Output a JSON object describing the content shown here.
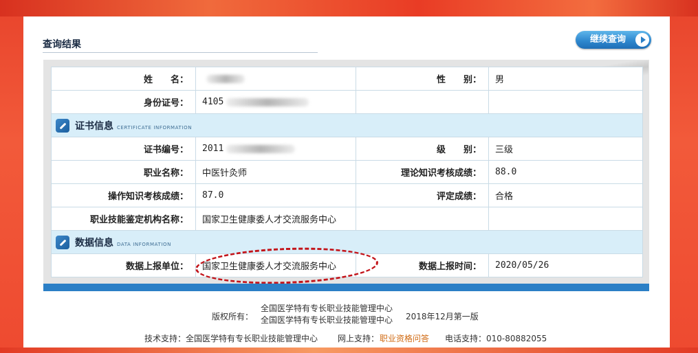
{
  "header": {
    "title": "查询结果",
    "continue_button": "继续查询"
  },
  "personal": {
    "name_label": "姓　　名：",
    "name_value": "",
    "gender_label": "性　　别：",
    "gender_value": "男",
    "id_label": "身份证号：",
    "id_value": "4105"
  },
  "certificate": {
    "section_title": "证书信息",
    "section_en": "CERTIFICATE INFORMATION",
    "cert_no_label": "证书编号：",
    "cert_no_value": "2011",
    "level_label": "级　　别：",
    "level_value": "三级",
    "job_label": "职业名称：",
    "job_value": "中医针灸师",
    "theory_label": "理论知识考核成绩：",
    "theory_value": "88.0",
    "practice_label": "操作知识考核成绩：",
    "practice_value": "87.0",
    "rating_label": "评定成绩：",
    "rating_value": "合格",
    "org_label": "职业技能鉴定机构名称：",
    "org_value": "国家卫生健康委人才交流服务中心"
  },
  "data_info": {
    "section_title": "数据信息",
    "section_en": "DATA INFORMATION",
    "unit_label": "数据上报单位：",
    "unit_value": "国家卫生健康委人才交流服务中心",
    "time_label": "数据上报时间：",
    "time_value": "2020/05/26"
  },
  "footer": {
    "copyright_label": "版权所有：",
    "copyright_line1": "全国医学特有专长职业技能管理中心",
    "copyright_line2": "全国医学特有专长职业技能管理中心",
    "edition": "2018年12月第一版",
    "tech_support": "技术支持：全国医学特有专长职业技能管理中心",
    "online_support_label": "网上支持：",
    "online_support_link": "职业资格问答",
    "phone": "电话支持：010-80882055"
  },
  "colors": {
    "accent_blue": "#2b7fc6",
    "section_bg": "#d8eef9",
    "annotation_red": "#c3141a",
    "link_orange": "#d06a12"
  }
}
